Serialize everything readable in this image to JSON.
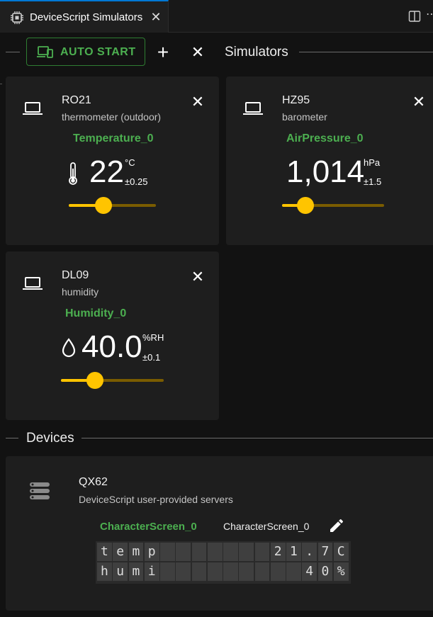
{
  "tab": {
    "title": "DeviceScript Simulators",
    "close": "✕"
  },
  "toolbar": {
    "auto_start_label": "AUTO START",
    "add_label": "+",
    "close_label": "✕",
    "section_title": "Simulators"
  },
  "simulators": [
    {
      "name": "RO21",
      "description": "thermometer (outdoor)",
      "service": "Temperature_0",
      "value": "22",
      "unit": "°C",
      "error": "±0.25",
      "icon": "thermometer-icon",
      "slider_level": 0.4
    },
    {
      "name": "HZ95",
      "description": "barometer",
      "service": "AirPressure_0",
      "value": "1,014",
      "unit": "hPa",
      "error": "±1.5",
      "icon": "none",
      "slider_level": 0.23
    },
    {
      "name": "DL09",
      "description": "humidity",
      "service": "Humidity_0",
      "value": "40.0",
      "unit": "%RH",
      "error": "±0.1",
      "icon": "water-drop-icon",
      "slider_level": 0.33
    }
  ],
  "devices": {
    "section_title": "Devices",
    "device": {
      "name": "QX62",
      "description": "DeviceScript user-provided servers",
      "service": "CharacterScreen_0",
      "service_instance": "CharacterScreen_0",
      "screen_rows": [
        [
          "t",
          "e",
          "m",
          "p",
          "",
          "",
          "",
          "",
          "",
          "",
          "",
          "2",
          "1",
          ".",
          "7",
          "C"
        ],
        [
          "h",
          "u",
          "m",
          "i",
          "",
          "",
          "",
          "",
          "",
          "",
          "",
          "",
          "",
          "4",
          "0",
          "%"
        ]
      ]
    }
  },
  "colors": {
    "accent_green": "#4caf50",
    "slider_yellow": "#ffc400",
    "tab_accent": "#0078d4"
  }
}
